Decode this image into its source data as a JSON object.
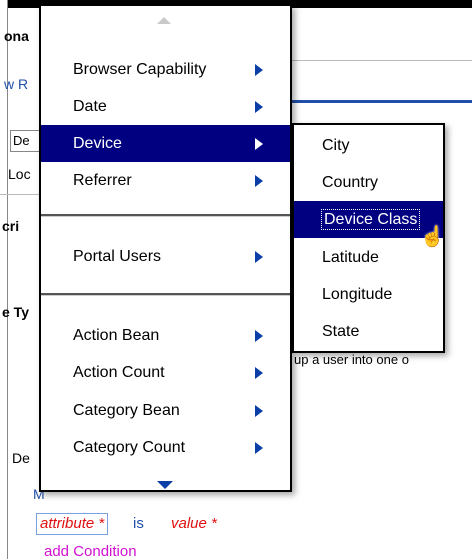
{
  "background": {
    "header_fragment": "ona",
    "link_fragment": "w R",
    "input_fragment": "De",
    "loc_fragment": "Loc",
    "section_fragment": "cri",
    "type_fragment": "e Ty",
    "desc_fragment": "up a user into one o",
    "bottom_fragment": "De",
    "m_fragment": "M",
    "condition": {
      "attribute": "attribute *",
      "is": "is",
      "value": "value *"
    },
    "add_condition": "add Condition"
  },
  "menu": {
    "group1": [
      {
        "label": "Browser Capability"
      },
      {
        "label": "Date"
      },
      {
        "label": "Device",
        "active": true
      },
      {
        "label": "Referrer"
      }
    ],
    "group2": [
      {
        "label": "Portal Users"
      }
    ],
    "group3": [
      {
        "label": "Action Bean"
      },
      {
        "label": "Action Count"
      },
      {
        "label": "Category Bean"
      },
      {
        "label": "Category Count"
      }
    ]
  },
  "submenu": {
    "items": [
      {
        "label": "City"
      },
      {
        "label": "Country"
      },
      {
        "label": "Device Class",
        "active": true
      },
      {
        "label": "Latitude"
      },
      {
        "label": "Longitude"
      },
      {
        "label": "State"
      }
    ]
  },
  "colors": {
    "menu_highlight": "#000080",
    "arrow": "#0a3fa8",
    "condition_red": "#e01010",
    "link_blue": "#1f4fa8",
    "add_condition": "#d010d0"
  }
}
